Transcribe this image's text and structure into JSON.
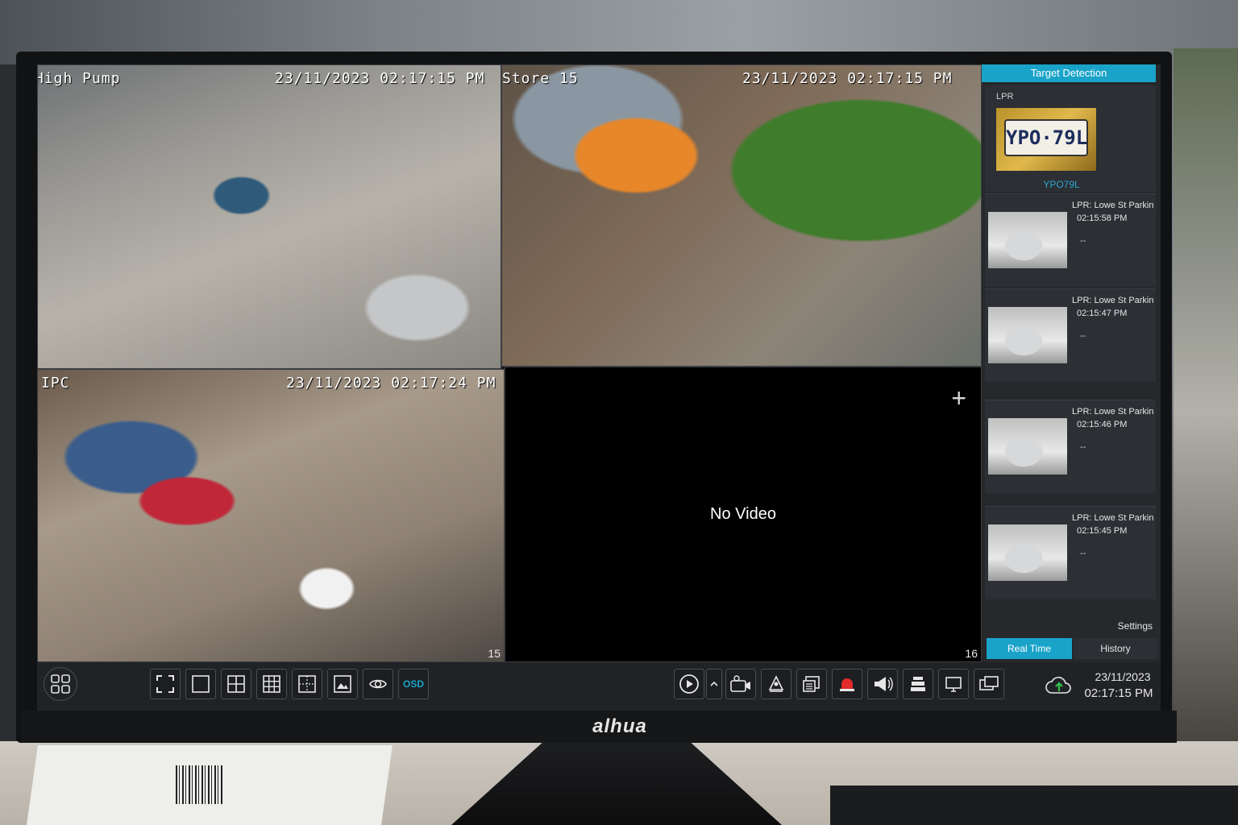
{
  "cameras": [
    {
      "name": "High Pump",
      "timestamp": "23/11/2023 02:17:15 PM",
      "channel": ""
    },
    {
      "name": "Store 15",
      "timestamp": "23/11/2023 02:17:15 PM",
      "channel": ""
    },
    {
      "name": "IPC",
      "timestamp": "23/11/2023 02:17:24 PM",
      "channel": "15"
    },
    {
      "name": "",
      "timestamp": "",
      "channel": "16",
      "status": "No Video"
    }
  ],
  "panel": {
    "title": "Target Detection",
    "lpr_label": "LPR",
    "plate_image_text": "YPO·79L",
    "plate_number": "YPO79L",
    "events": [
      {
        "title": "LPR: Lowe St Parkin",
        "time": "02:15:58 PM",
        "detail": "--"
      },
      {
        "title": "LPR: Lowe St Parkin",
        "time": "02:15:47 PM",
        "detail": "--"
      },
      {
        "title": "LPR: Lowe St Parkin",
        "time": "02:15:46 PM",
        "detail": "--"
      },
      {
        "title": "LPR: Lowe St Parkin",
        "time": "02:15:45 PM",
        "detail": "--"
      }
    ],
    "settings_label": "Settings",
    "tab_realtime": "Real Time",
    "tab_history": "History"
  },
  "toolbar": {
    "osd_label": "OSD",
    "date": "23/11/2023",
    "time": "02:17:15 PM",
    "left_icons": [
      "fullscreen-icon",
      "layout-1-icon",
      "layout-4-icon",
      "layout-9-icon",
      "custom-layout-icon",
      "image-adjust-icon",
      "patrol-icon"
    ],
    "right_icons": [
      "play-icon",
      "chevron-up-icon",
      "capture-icon",
      "alarm-user-icon",
      "record-icon",
      "siren-icon",
      "broadcast-icon",
      "stack-icon",
      "screen-icon",
      "multi-screen-icon"
    ]
  },
  "brand": "alhua",
  "colors": {
    "accent": "#1aa3c9",
    "toolbar_bg": "#202225",
    "panel_bg": "#26282b"
  }
}
